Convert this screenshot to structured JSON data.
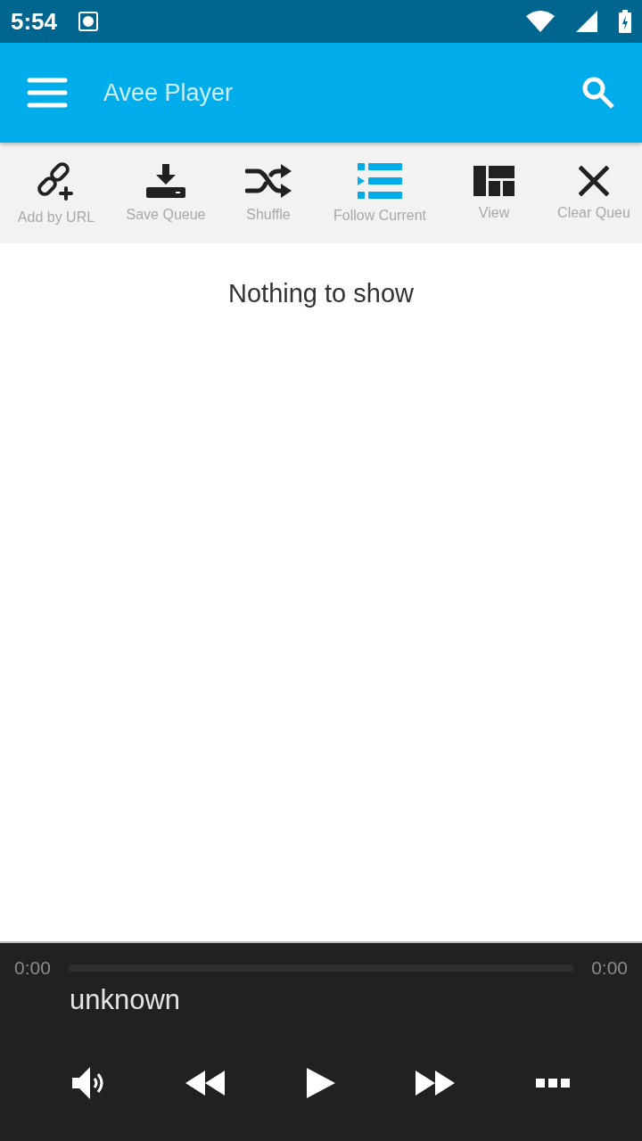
{
  "status_bar": {
    "time": "5:54"
  },
  "app_bar": {
    "title": "Avee Player"
  },
  "toolbar": [
    {
      "kind": "link",
      "label": "Add by URL",
      "active": false
    },
    {
      "kind": "save",
      "label": "Save Queue",
      "active": false
    },
    {
      "kind": "shuffle",
      "label": "Shuffle",
      "active": false
    },
    {
      "kind": "follow",
      "label": "Follow Current",
      "active": true
    },
    {
      "kind": "view",
      "label": "View",
      "active": false
    },
    {
      "kind": "clear",
      "label": "Clear Queu",
      "active": false
    }
  ],
  "empty_message": "Nothing to show",
  "player": {
    "elapsed": "0:00",
    "duration": "0:00",
    "level": 0,
    "track": "unknown"
  }
}
